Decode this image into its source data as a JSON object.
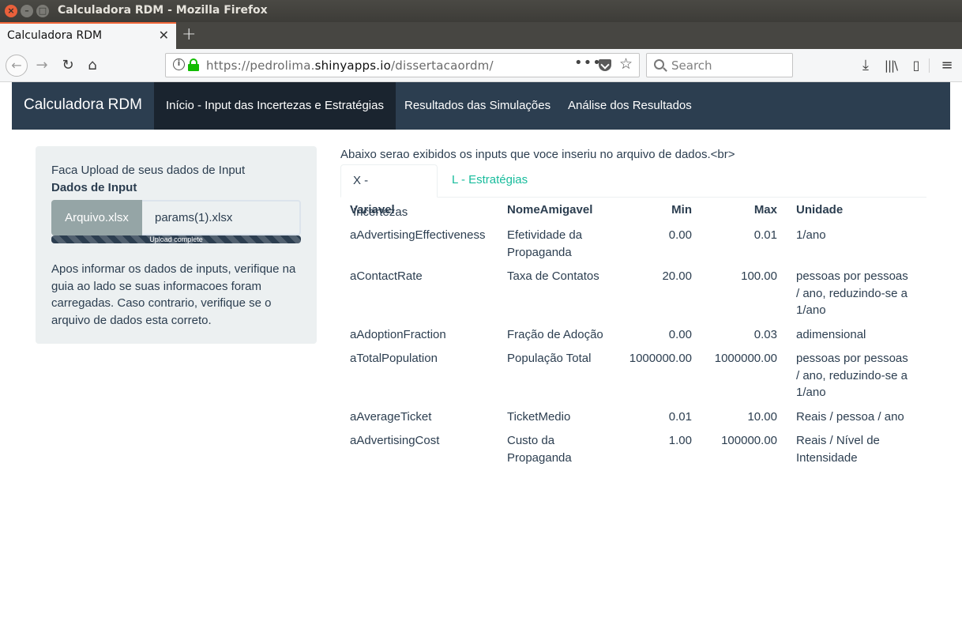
{
  "window": {
    "title": "Calculadora RDM - Mozilla Firefox"
  },
  "browser": {
    "tab_label": "Calculadora RDM",
    "url_prefix": "https://pedrolima.",
    "url_domain": "shinyapps.io",
    "url_path": "/dissertacaordm/",
    "search_placeholder": "Search"
  },
  "app": {
    "brand": "Calculadora RDM",
    "nav": [
      {
        "label": "Início - Input das Incertezas e Estratégias"
      },
      {
        "label": "Resultados das Simulações"
      },
      {
        "label": "Análise dos Resultados"
      }
    ]
  },
  "sidebar": {
    "upload_label": "Faca Upload de seus dados de Input",
    "upload_title": "Dados de Input",
    "file_button": "Arquivo.xlsx",
    "file_name": "params(1).xlsx",
    "progress_text": "Upload complete",
    "progress_fraction": 1.0,
    "help_text": "Apos informar os dados de inputs, verifique na guia ao lado se suas informacoes foram carregadas. Caso contrario, verifique se o arquivo de dados esta correto."
  },
  "main": {
    "intro": "Abaixo serao exibidos os inputs que voce inseriu no arquivo de dados.<br>",
    "tabs": [
      {
        "label": "X - Incertezas"
      },
      {
        "label": "L - Estratégias"
      }
    ],
    "table": {
      "headers": [
        "Variavel",
        "NomeAmigavel",
        "Min",
        "Max",
        "Unidade"
      ],
      "rows": [
        [
          "aAdvertisingEffectiveness",
          "Efetividade da Propaganda",
          "0.00",
          "0.01",
          "1/ano"
        ],
        [
          "aContactRate",
          "Taxa de Contatos",
          "20.00",
          "100.00",
          "pessoas por pessoas / ano, reduzindo-se a 1/ano"
        ],
        [
          "aAdoptionFraction",
          "Fração de Adoção",
          "0.00",
          "0.03",
          "adimensional"
        ],
        [
          "aTotalPopulation",
          "População Total",
          "1000000.00",
          "1000000.00",
          "pessoas por pessoas / ano, reduzindo-se a 1/ano"
        ],
        [
          "aAverageTicket",
          "TicketMedio",
          "0.01",
          "10.00",
          "Reais / pessoa / ano"
        ],
        [
          "aAdvertisingCost",
          "Custo da Propaganda",
          "1.00",
          "100000.00",
          "Reais / Nível de Intensidade"
        ]
      ]
    }
  }
}
